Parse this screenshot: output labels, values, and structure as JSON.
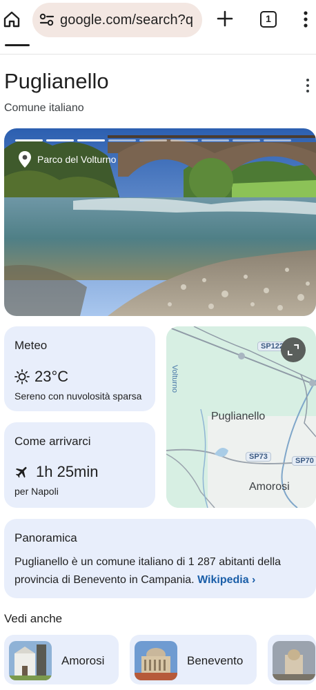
{
  "browser": {
    "url": "google.com/search?q",
    "tab_count": "1"
  },
  "entity": {
    "title": "Puglianello",
    "subtitle": "Comune italiano"
  },
  "hero": {
    "location": "Parco del Volturno",
    "slides_total": 9,
    "slides_active": 3
  },
  "weather": {
    "title": "Meteo",
    "temperature": "23°C",
    "condition": "Sereno con nuvolosità sparsa"
  },
  "travel": {
    "title": "Come arrivarci",
    "duration": "1h 25min",
    "destination": "per Napoli"
  },
  "map": {
    "place": "Puglianello",
    "nearby": "Amorosi",
    "roads": [
      "SP122",
      "SP73",
      "SP70"
    ],
    "side_label": "Volturno"
  },
  "overview": {
    "title": "Panoramica",
    "text": "Puglianello è un comune italiano di 1 287 abitanti della provincia di Benevento in Campania.",
    "link": "Wikipedia ›"
  },
  "see_also": {
    "title": "Vedi anche",
    "items": [
      {
        "label": "Amorosi"
      },
      {
        "label": "Benevento"
      },
      {
        "label": ""
      }
    ]
  }
}
